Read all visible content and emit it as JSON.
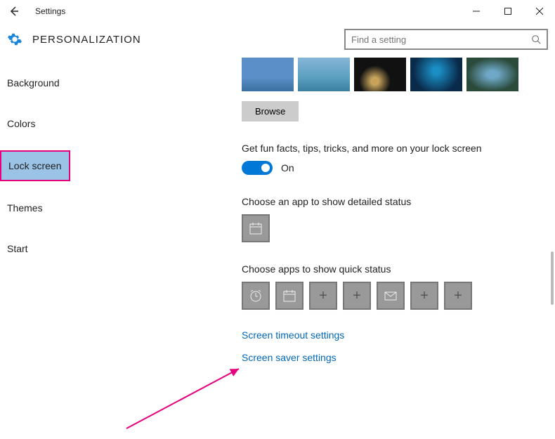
{
  "window": {
    "title": "Settings"
  },
  "category": "PERSONALIZATION",
  "search": {
    "placeholder": "Find a setting"
  },
  "sidebar": {
    "items": [
      {
        "label": "Background"
      },
      {
        "label": "Colors"
      },
      {
        "label": "Lock screen"
      },
      {
        "label": "Themes"
      },
      {
        "label": "Start"
      }
    ],
    "active_index": 2
  },
  "lockscreen": {
    "browse_label": "Browse",
    "fun_facts_label": "Get fun facts, tips, tricks, and more on your lock screen",
    "fun_facts_state": "On",
    "detailed_label": "Choose an app to show detailed status",
    "quick_label": "Choose apps to show quick status",
    "link_timeout": "Screen timeout settings",
    "link_saver": "Screen saver settings"
  }
}
